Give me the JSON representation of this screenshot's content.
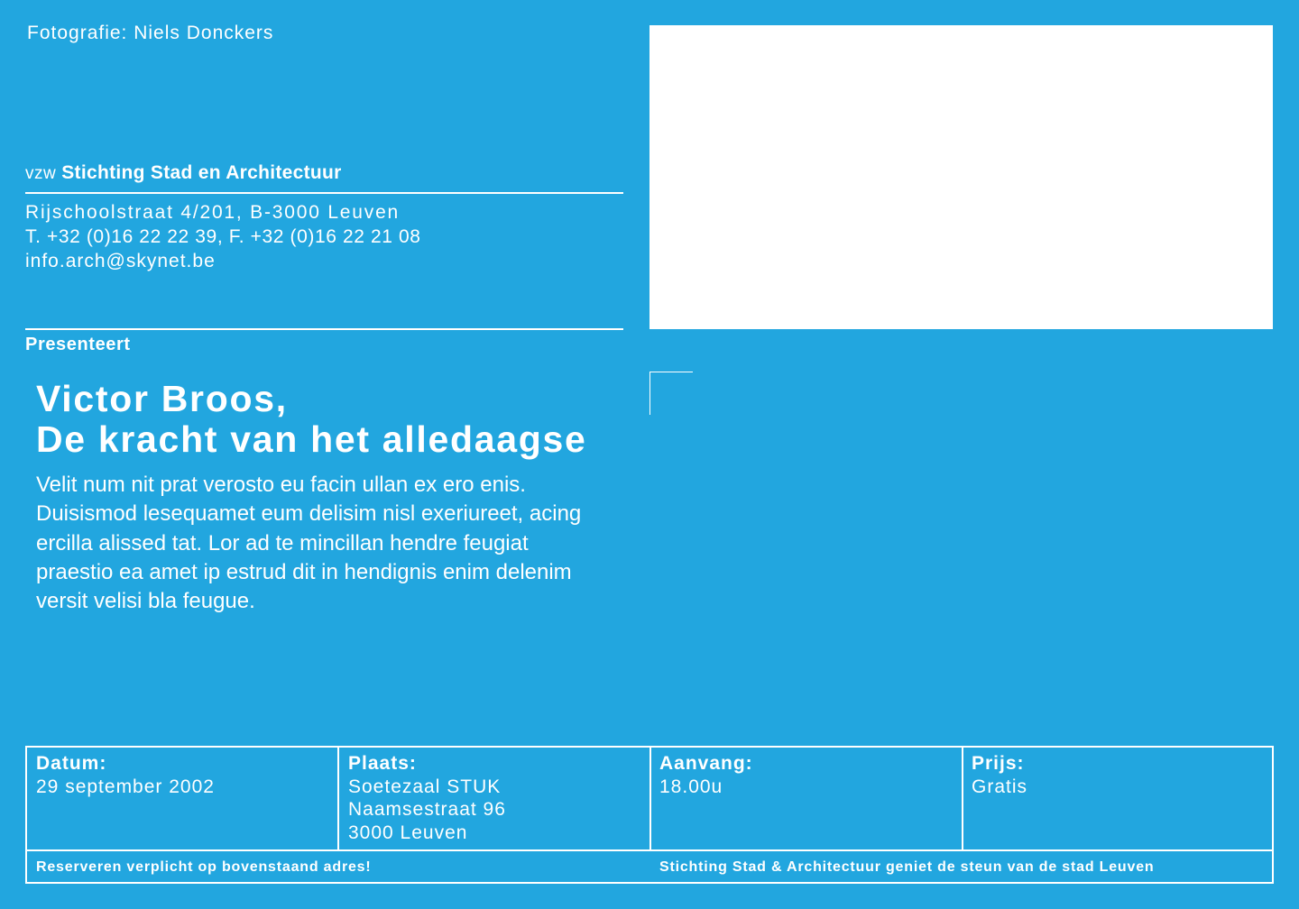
{
  "photo_credit": "Fotografie: Niels Donckers",
  "organization": {
    "prefix": "vzw",
    "name": "Stichting Stad en Architectuur",
    "address": "Rijschoolstraat 4/201, B-3000 Leuven",
    "phone_fax": "T. +32 (0)16 22 22 39, F. +32 (0)16 22 21 08",
    "email": "info.arch@skynet.be"
  },
  "presents_label": "Presenteert",
  "title": {
    "line1": "Victor Broos,",
    "line2": "De kracht van het alledaagse"
  },
  "description": [
    "Velit num nit prat verosto eu facin ullan ex ero enis.",
    "Duisismod lesequamet eum delisim nisl exeriureet, acing",
    "ercilla alissed tat. Lor ad te mincillan hendre feugiat",
    "praestio ea amet ip estrud dit in hendignis enim delenim",
    "versit velisi bla feugue."
  ],
  "event": {
    "date": {
      "label": "Datum:",
      "lines": [
        "29 september 2002"
      ]
    },
    "place": {
      "label": "Plaats:",
      "lines": [
        "Soetezaal STUK",
        "Naamsestraat 96",
        "3000 Leuven"
      ]
    },
    "start": {
      "label": "Aanvang:",
      "lines": [
        "18.00u"
      ]
    },
    "price": {
      "label": "Prijs:",
      "lines": [
        "Gratis"
      ]
    }
  },
  "footer": {
    "left": "Reserveren verplicht op bovenstaand adres!",
    "right": "Stichting Stad & Architectuur geniet de steun van de stad Leuven"
  },
  "colors": {
    "background": "#22a6df",
    "foreground": "#ffffff"
  }
}
